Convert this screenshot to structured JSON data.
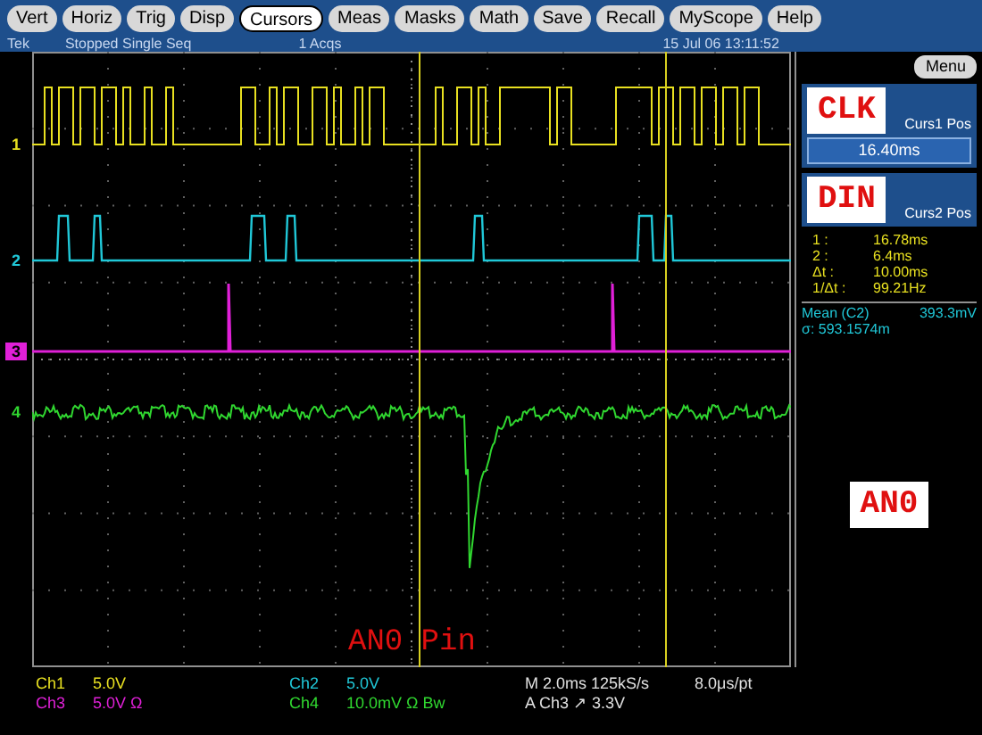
{
  "menu": [
    {
      "label": "Vert",
      "selected": false
    },
    {
      "label": "Horiz",
      "selected": false
    },
    {
      "label": "Trig",
      "selected": false
    },
    {
      "label": "Disp",
      "selected": false
    },
    {
      "label": "Cursors",
      "selected": true
    },
    {
      "label": "Meas",
      "selected": false
    },
    {
      "label": "Masks",
      "selected": false
    },
    {
      "label": "Math",
      "selected": false
    },
    {
      "label": "Save",
      "selected": false
    },
    {
      "label": "Recall",
      "selected": false
    },
    {
      "label": "MyScope",
      "selected": false
    },
    {
      "label": "Help",
      "selected": false
    }
  ],
  "status": {
    "logo": "Tek",
    "state": "Stopped Single Seq",
    "acqs": "1 Acqs",
    "datetime": "15 Jul 06 13:11:52"
  },
  "channels": [
    {
      "marker": "1",
      "color": "#e8e020"
    },
    {
      "marker": "2",
      "color": "#20c8d8"
    },
    {
      "marker": "3",
      "color": "#e020d8"
    },
    {
      "marker": "4",
      "color": "#30d830"
    }
  ],
  "annotations": [
    {
      "text": "CLK"
    },
    {
      "text": "DIN"
    },
    {
      "text": "AN0"
    },
    {
      "text": "AN0 Pin"
    }
  ],
  "side_panel": {
    "menu_button": "Menu",
    "cursor1": {
      "label": "Curs1 Pos",
      "value": "16.40ms"
    },
    "cursor2": {
      "label": "Curs2 Pos"
    },
    "readouts": [
      {
        "label": "1 :",
        "value": "16.78ms"
      },
      {
        "label": "2 :",
        "value": "6.4ms"
      },
      {
        "label": "Δt :",
        "value": "10.00ms"
      },
      {
        "label": "1/Δt :",
        "value": "99.21Hz"
      }
    ],
    "measurement": {
      "label": "Mean (C2)",
      "value": "393.3mV",
      "sigma": "σ: 593.1574m"
    }
  },
  "bottom": {
    "rows": [
      [
        {
          "text": "Ch1",
          "color": "#e8e020"
        },
        {
          "text": "5.0V",
          "color": "#e8e020"
        },
        {
          "text": "Ch2",
          "color": "#20c8d8"
        },
        {
          "text": "5.0V",
          "color": "#20c8d8"
        },
        {
          "text": "M 2.0ms 125kS/s",
          "color": "#e0e0e0"
        },
        {
          "text": "8.0μs/pt",
          "color": "#e0e0e0"
        }
      ],
      [
        {
          "text": "Ch3",
          "color": "#e020d8"
        },
        {
          "text": "5.0V  Ω",
          "color": "#e020d8"
        },
        {
          "text": "Ch4",
          "color": "#30d830"
        },
        {
          "text": "10.0mV Ω Bw",
          "color": "#30d830"
        },
        {
          "text": "A Ch3 ↗ 3.3V",
          "color": "#e0e0e0"
        }
      ]
    ]
  }
}
